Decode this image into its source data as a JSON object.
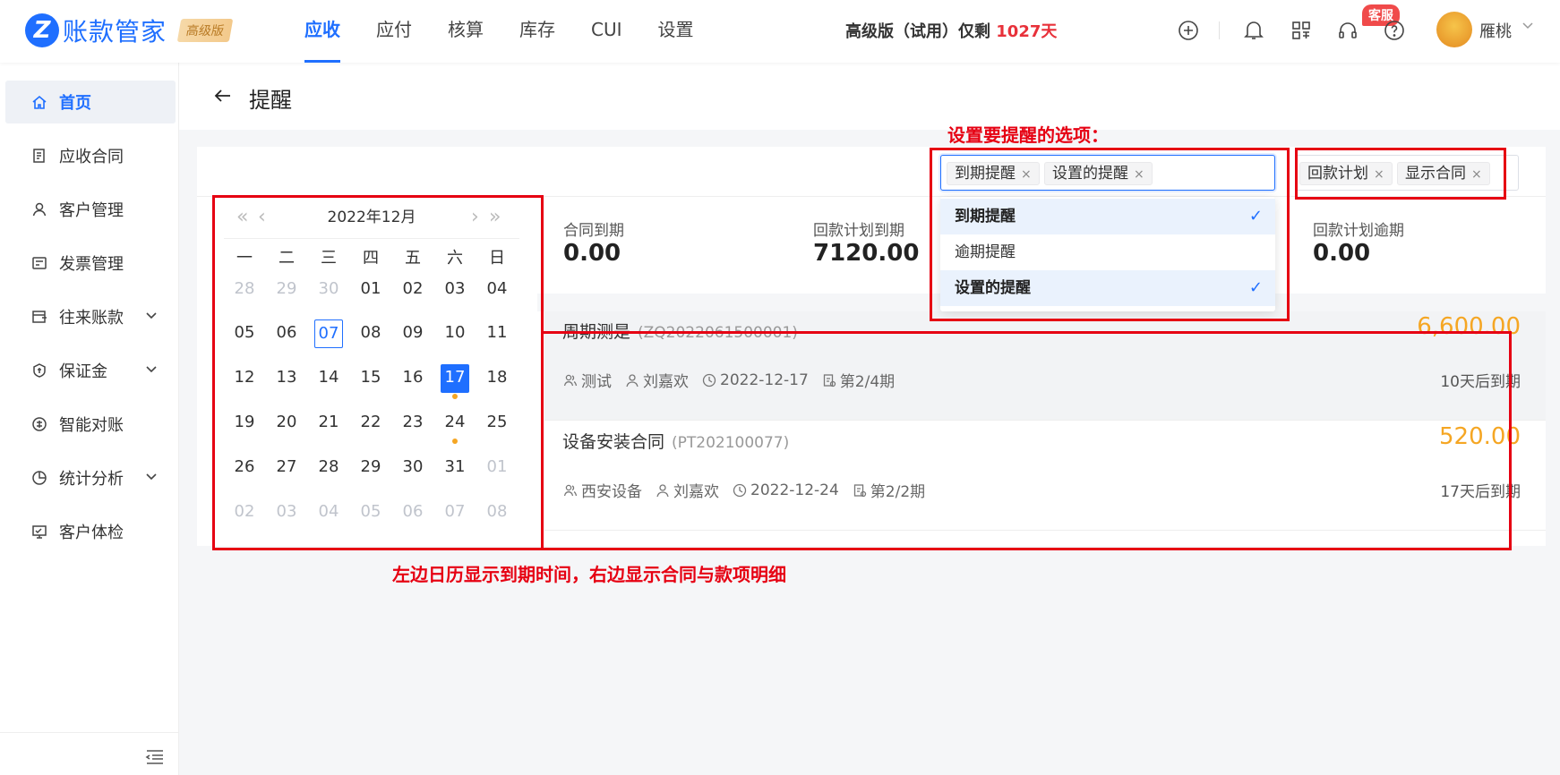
{
  "header": {
    "logo_letter": "Z",
    "app_name": "账款管家",
    "edition": "高级版",
    "nav": [
      "应收",
      "应付",
      "核算",
      "库存",
      "CUI",
      "设置"
    ],
    "nav_active": 0,
    "trial_prefix": "高级版（试用）仅剩 ",
    "trial_days": "1027天",
    "kefu_badge": "客服",
    "user_name": "雁桃",
    "icons": [
      "add-circle-icon",
      "bell-icon",
      "apps-grid-icon",
      "headset-icon",
      "help-icon"
    ]
  },
  "sidebar": {
    "items": [
      {
        "label": "首页",
        "icon": "home-icon",
        "active": true
      },
      {
        "label": "应收合同",
        "icon": "contract-icon"
      },
      {
        "label": "客户管理",
        "icon": "customer-icon"
      },
      {
        "label": "发票管理",
        "icon": "invoice-icon"
      },
      {
        "label": "往来账款",
        "icon": "ledger-icon",
        "expandable": true
      },
      {
        "label": "保证金",
        "icon": "deposit-icon",
        "expandable": true
      },
      {
        "label": "智能对账",
        "icon": "reconcile-icon"
      },
      {
        "label": "统计分析",
        "icon": "chart-icon",
        "expandable": true
      },
      {
        "label": "客户体检",
        "icon": "checkup-icon"
      }
    ]
  },
  "page": {
    "title": "提醒"
  },
  "reminder_select": {
    "tags": [
      "到期提醒",
      "设置的提醒"
    ],
    "options": [
      {
        "label": "到期提醒",
        "selected": true
      },
      {
        "label": "逾期提醒",
        "selected": false
      },
      {
        "label": "设置的提醒",
        "selected": true
      }
    ]
  },
  "display_select": {
    "tags": [
      "回款计划",
      "显示合同"
    ]
  },
  "calendar": {
    "title": "2022年12月",
    "weekdays": [
      "一",
      "二",
      "三",
      "四",
      "五",
      "六",
      "日"
    ],
    "weeks": [
      [
        "28",
        "29",
        "30",
        "01",
        "02",
        "03",
        "04"
      ],
      [
        "05",
        "06",
        "07",
        "08",
        "09",
        "10",
        "11"
      ],
      [
        "12",
        "13",
        "14",
        "15",
        "16",
        "17",
        "18"
      ],
      [
        "19",
        "20",
        "21",
        "22",
        "23",
        "24",
        "25"
      ],
      [
        "26",
        "27",
        "28",
        "29",
        "30",
        "31",
        "01"
      ],
      [
        "02",
        "03",
        "04",
        "05",
        "06",
        "07",
        "08"
      ]
    ],
    "today": "07",
    "selected": "17",
    "marked_days": [
      "17",
      "24"
    ],
    "dot_color": "#f5a623"
  },
  "stats": [
    {
      "label": "合同到期",
      "value": "0.00"
    },
    {
      "label": "回款计划到期",
      "value": "7120.00"
    },
    {
      "label": "回款计划逾期",
      "value": "0.00"
    }
  ],
  "contracts": [
    {
      "name": "周期测是",
      "code": "(ZQ2022061500001)",
      "amount": "6,600.00",
      "customer": "测试",
      "owner": "刘嘉欢",
      "date": "2022-12-17",
      "period": "第2/4期",
      "due": "10天后到期"
    },
    {
      "name": "设备安装合同",
      "code": "(PT202100077)",
      "amount": "520.00",
      "customer": "西安设备",
      "owner": "刘嘉欢",
      "date": "2022-12-24",
      "period": "第2/2期",
      "due": "17天后到期"
    }
  ],
  "annotations": {
    "top": "设置要提醒的选项：",
    "bottom": "左边日历显示到期时间，右边显示合同与款项明细",
    "color": "#e60012"
  },
  "colors": {
    "brand": "#1f6fff",
    "amount": "#f5a623",
    "trial_days": "#e8313a"
  }
}
